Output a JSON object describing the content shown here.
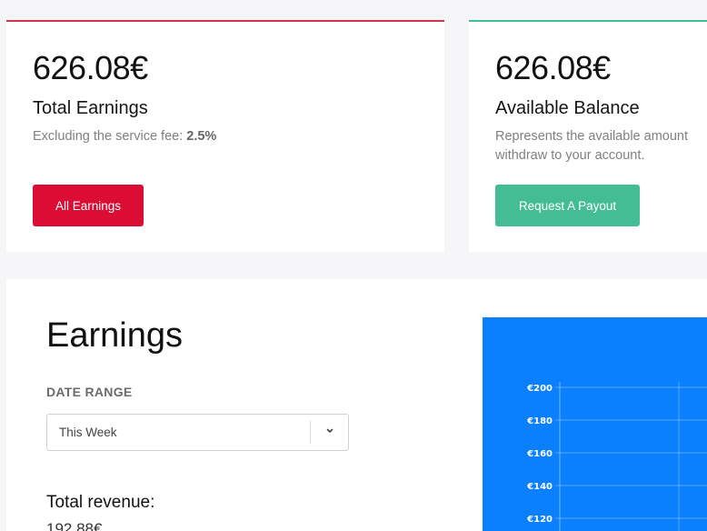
{
  "cards": {
    "earnings": {
      "amount": "626.08€",
      "title": "Total Earnings",
      "desc_prefix": "Excluding the service fee: ",
      "fee": "2.5%",
      "button": "All Earnings",
      "accent": "#d3324f",
      "button_color": "#dc0d35"
    },
    "balance": {
      "amount": "626.08€",
      "title": "Available Balance",
      "desc_line1": "Represents the available amount",
      "desc_line2": "withdraw to your account.",
      "button": "Request A Payout",
      "accent": "#3fbf99",
      "button_color": "#44bd94"
    }
  },
  "earnings_panel": {
    "title": "Earnings",
    "date_range_label": "DATE RANGE",
    "date_range_value": "This Week",
    "revenue_label": "Total revenue:",
    "revenue_value": "192.88€"
  },
  "chart_data": {
    "type": "bar",
    "title": "",
    "xlabel": "",
    "ylabel": "",
    "y_ticks": [
      "€200",
      "€180",
      "€160",
      "€140",
      "€120"
    ],
    "ylim": [
      100,
      200
    ],
    "grid": true,
    "background": "#0a80ff",
    "series": []
  },
  "icons": {
    "caret": "chevron-down-icon"
  }
}
